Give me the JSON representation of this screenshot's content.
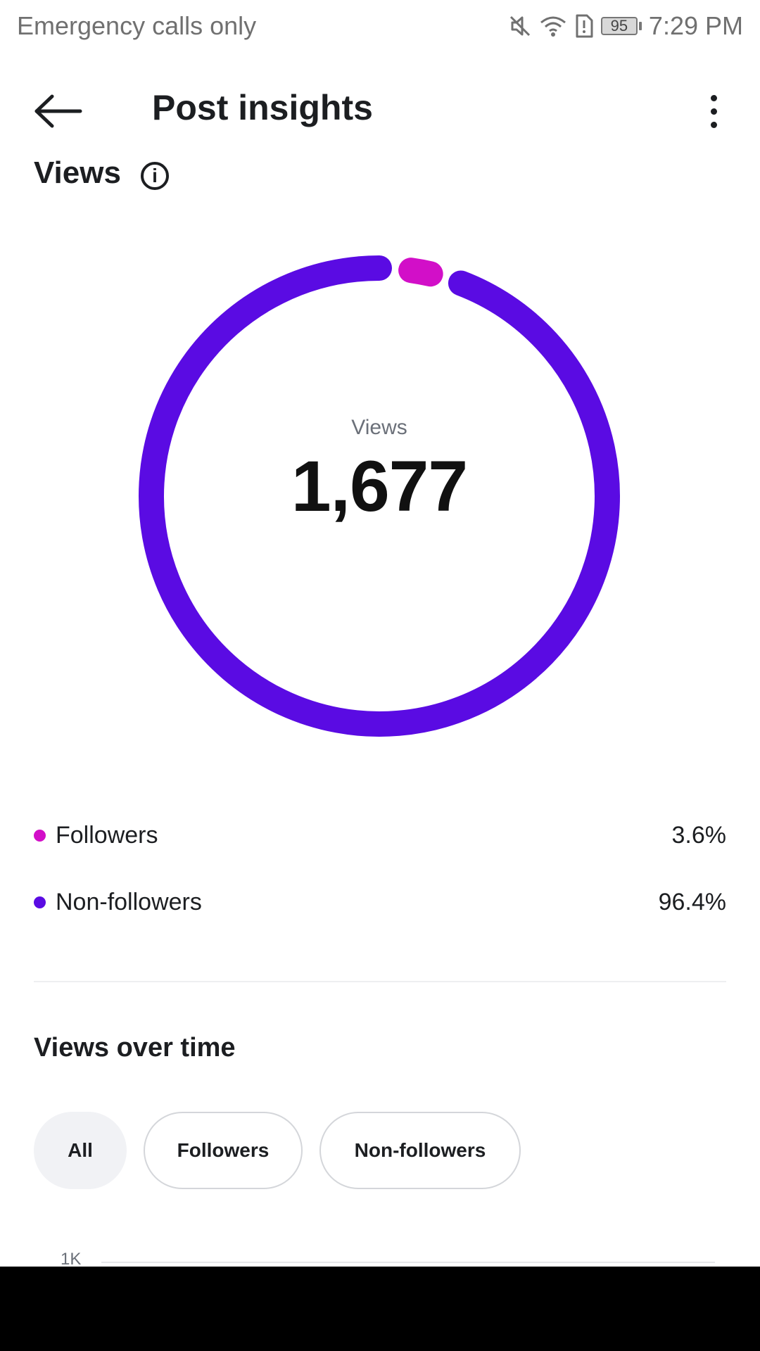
{
  "status_bar": {
    "carrier_text": "Emergency calls only",
    "battery_level": "95",
    "time": "7:29 PM",
    "icons": [
      "mute-icon",
      "wifi-icon",
      "sim-alert-icon",
      "battery-icon"
    ]
  },
  "header": {
    "title": "Post insights",
    "back_icon": "back-arrow-icon",
    "more_icon": "more-vertical-icon"
  },
  "views_section": {
    "title": "Views",
    "info_icon": "i"
  },
  "donut": {
    "center_label": "Views",
    "center_value": "1,677"
  },
  "chart_data": {
    "type": "pie",
    "categories": [
      "Followers",
      "Non-followers"
    ],
    "values": [
      3.6,
      96.4
    ],
    "colors": [
      "#d20fc8",
      "#5a0be3"
    ],
    "total_label": "Views",
    "total": 1677
  },
  "legend": [
    {
      "label": "Followers",
      "value": "3.6%",
      "color": "#d20fc8"
    },
    {
      "label": "Non-followers",
      "value": "96.4%",
      "color": "#5a0be3"
    }
  ],
  "views_over_time": {
    "title": "Views over time",
    "chips": [
      {
        "label": "All",
        "active": true
      },
      {
        "label": "Followers",
        "active": false
      },
      {
        "label": "Non-followers",
        "active": false
      }
    ],
    "y_axis_top_tick": "1K"
  }
}
